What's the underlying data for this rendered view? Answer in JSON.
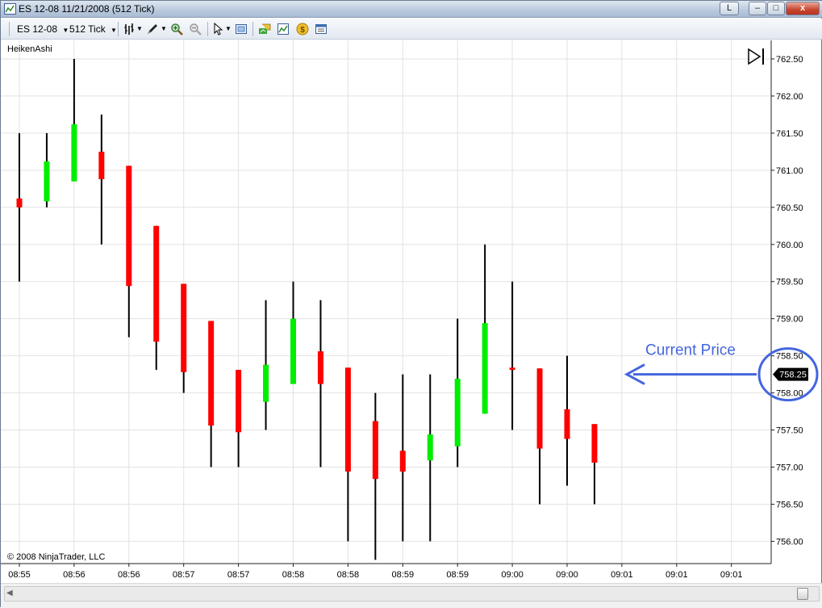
{
  "window": {
    "title": "ES 12-08  11/21/2008 (512 Tick)",
    "link_button_label": "L",
    "minimize_label": "–",
    "maximize_label": "□",
    "close_label": "x"
  },
  "toolbar": {
    "instrument": "ES 12-08",
    "interval": "512 Tick"
  },
  "chart": {
    "indicator_label": "HeikenAshi",
    "copyright": "© 2008 NinjaTrader, LLC",
    "current_price_label": "758.25",
    "annotation_text": "Current Price",
    "colors": {
      "up": "#00ee00",
      "down": "#ff0000",
      "wick": "#000000",
      "grid": "#e2e2e2",
      "annotation": "#4466dd",
      "price_marker_bg": "#000000",
      "price_marker_text": "#ffffff"
    }
  },
  "chart_data": {
    "type": "candlestick",
    "title": "",
    "xlabel": "",
    "ylabel": "",
    "ylim": [
      755.7,
      762.75
    ],
    "y_ticks": [
      756.0,
      756.5,
      757.0,
      757.5,
      758.0,
      758.5,
      759.0,
      759.5,
      760.0,
      760.5,
      761.0,
      761.5,
      762.0,
      762.5
    ],
    "y_tick_labels": [
      "756.00",
      "756.50",
      "757.00",
      "757.50",
      "758.00",
      "758.50",
      "759.00",
      "759.50",
      "760.00",
      "760.50",
      "761.00",
      "761.50",
      "762.00",
      "762.50"
    ],
    "x_tick_labels": [
      "08:55",
      "08:56",
      "08:56",
      "08:57",
      "08:57",
      "08:58",
      "08:58",
      "08:59",
      "08:59",
      "09:00",
      "09:00",
      "09:01",
      "09:01",
      "09:01"
    ],
    "current_price": 758.25,
    "candles": [
      {
        "open": 760.5,
        "close": 760.62,
        "high": 761.5,
        "low": 759.5,
        "dir": "down"
      },
      {
        "open": 760.58,
        "close": 761.12,
        "high": 761.5,
        "low": 760.5,
        "dir": "up"
      },
      {
        "open": 760.85,
        "close": 761.62,
        "high": 762.5,
        "low": 760.85,
        "dir": "up"
      },
      {
        "open": 761.25,
        "close": 760.88,
        "high": 761.75,
        "low": 760.0,
        "dir": "down"
      },
      {
        "open": 761.06,
        "close": 759.44,
        "high": 761.06,
        "low": 758.75,
        "dir": "down"
      },
      {
        "open": 760.25,
        "close": 758.69,
        "high": 760.25,
        "low": 758.31,
        "dir": "down"
      },
      {
        "open": 759.47,
        "close": 758.28,
        "high": 759.47,
        "low": 758.0,
        "dir": "down"
      },
      {
        "open": 758.97,
        "close": 757.56,
        "high": 758.97,
        "low": 757.0,
        "dir": "down"
      },
      {
        "open": 758.31,
        "close": 757.47,
        "high": 758.31,
        "low": 757.0,
        "dir": "down"
      },
      {
        "open": 757.88,
        "close": 758.38,
        "high": 759.25,
        "low": 757.5,
        "dir": "up"
      },
      {
        "open": 758.12,
        "close": 759.0,
        "high": 759.5,
        "low": 758.12,
        "dir": "up"
      },
      {
        "open": 758.56,
        "close": 758.12,
        "high": 759.25,
        "low": 757.0,
        "dir": "down"
      },
      {
        "open": 758.34,
        "close": 756.94,
        "high": 758.34,
        "low": 756.0,
        "dir": "down"
      },
      {
        "open": 757.62,
        "close": 756.84,
        "high": 758.0,
        "low": 755.75,
        "dir": "down"
      },
      {
        "open": 757.22,
        "close": 756.94,
        "high": 758.25,
        "low": 756.0,
        "dir": "down"
      },
      {
        "open": 757.09,
        "close": 757.44,
        "high": 758.25,
        "low": 756.0,
        "dir": "up"
      },
      {
        "open": 757.28,
        "close": 758.19,
        "high": 759.0,
        "low": 757.0,
        "dir": "up"
      },
      {
        "open": 757.72,
        "close": 758.94,
        "high": 760.0,
        "low": 757.72,
        "dir": "up"
      },
      {
        "open": 758.34,
        "close": 758.31,
        "high": 759.5,
        "low": 757.5,
        "dir": "down"
      },
      {
        "open": 758.33,
        "close": 757.25,
        "high": 758.33,
        "low": 756.5,
        "dir": "down"
      },
      {
        "open": 757.78,
        "close": 757.38,
        "high": 758.5,
        "low": 756.75,
        "dir": "down"
      },
      {
        "open": 757.58,
        "close": 757.06,
        "high": 757.58,
        "low": 756.5,
        "dir": "down"
      }
    ]
  }
}
